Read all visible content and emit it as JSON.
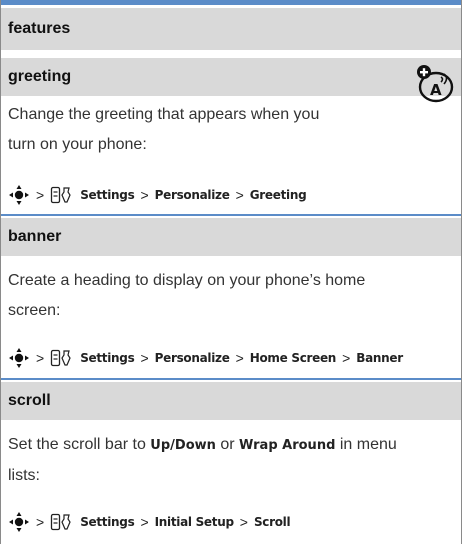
{
  "header": {
    "title": "features"
  },
  "sections": [
    {
      "title": "greeting",
      "desc_line1": "Change the greeting that appears when you",
      "desc_line2": "turn on your phone:",
      "path": [
        "Settings",
        "Personalize",
        "Greeting"
      ]
    },
    {
      "title": "banner",
      "desc_line1": "Create a heading to display on your phone’s home",
      "desc_line2": "screen:",
      "path": [
        "Settings",
        "Personalize",
        "Home Screen",
        "Banner"
      ]
    },
    {
      "title": "scroll",
      "desc_line1_a": "Set the scroll bar to ",
      "desc_line1_b": "Up/Down",
      "desc_line1_c": " or ",
      "desc_line1_d": "Wrap Around",
      "desc_line1_e": " in menu",
      "desc_line2": "lists:",
      "path": [
        "Settings",
        "Initial Setup",
        "Scroll"
      ]
    }
  ],
  "path_separator": ">",
  "icons": {
    "nav_key": "nav-key-icon",
    "settings": "settings-icon",
    "feature_marker": "network-feature-icon"
  },
  "colors": {
    "accent": "#5b8cc8",
    "band": "#d9d9d9"
  }
}
